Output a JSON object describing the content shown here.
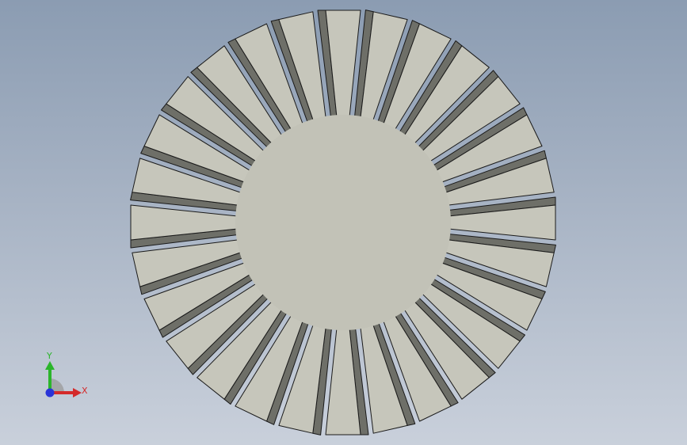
{
  "viewport": {
    "background_top": "#8b9cb2",
    "background_bottom": "#c9d0db"
  },
  "model": {
    "part": "radial-finned-heatsink",
    "fin_count": 28,
    "colors": {
      "face": "#c2c2b7",
      "fin_top": "#c6c6bb",
      "fin_side": "#6e6f68",
      "edge": "#1a1a1a"
    }
  },
  "triad": {
    "x_label": "X",
    "y_label": "Y",
    "x_color": "#d42a2a",
    "y_color": "#2bb52b",
    "z_color": "#2a34d8"
  }
}
